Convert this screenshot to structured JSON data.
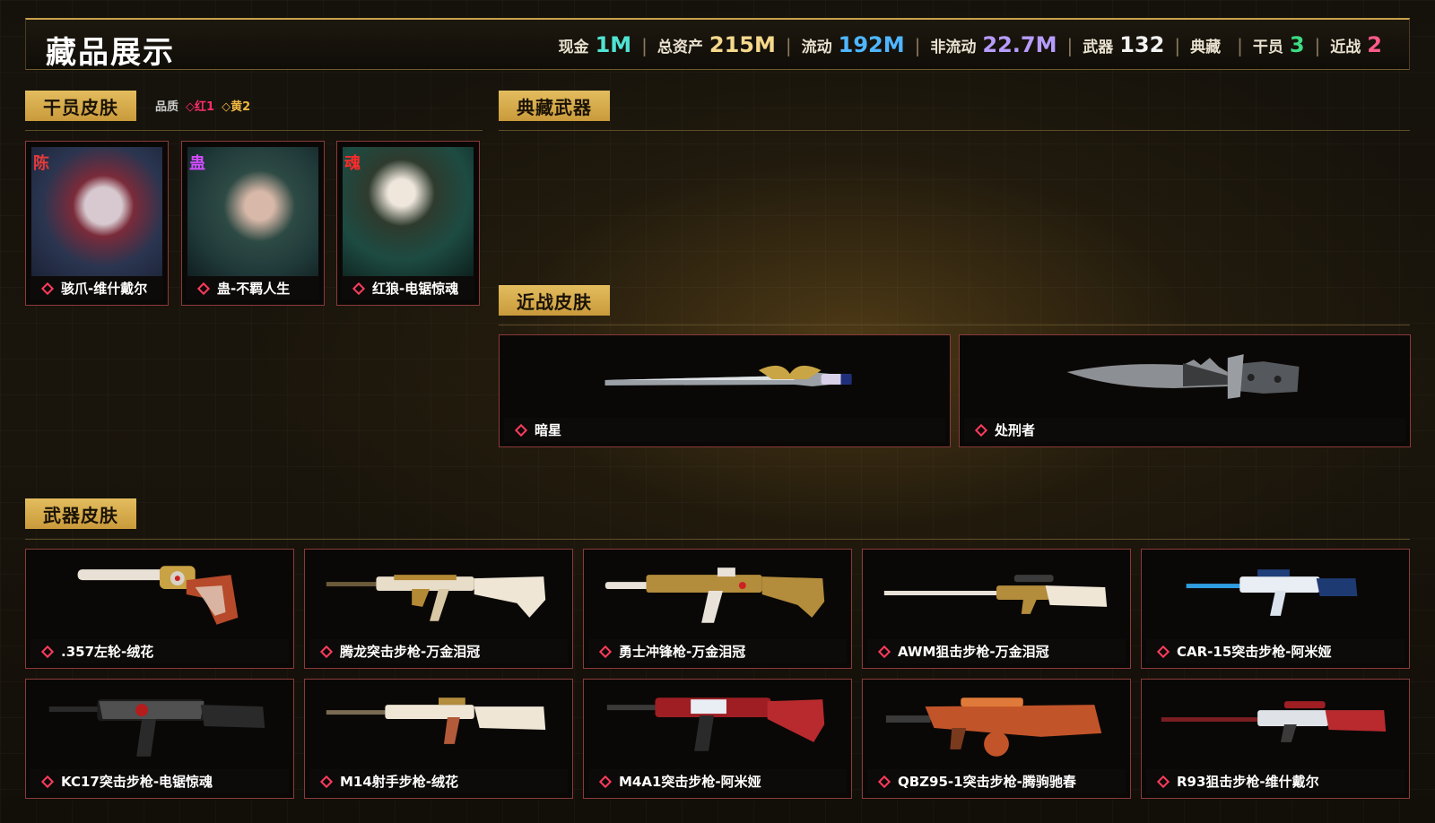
{
  "header": {
    "title": "藏品展示",
    "stats": [
      {
        "label": "现金",
        "value": "1M",
        "color": "#4fe3d2"
      },
      {
        "label": "总资产",
        "value": "215M",
        "color": "#f5d98c"
      },
      {
        "label": "流动",
        "value": "192M",
        "color": "#4fb6ff"
      },
      {
        "label": "非流动",
        "value": "22.7M",
        "color": "#b79cff"
      },
      {
        "label": "武器",
        "value": "132",
        "color": "#f2f2f2"
      },
      {
        "label": "典藏",
        "value": "",
        "color": "#f2f2f2"
      },
      {
        "label": "干员",
        "value": "3",
        "color": "#3ddc84"
      },
      {
        "label": "近战",
        "value": "2",
        "color": "#ff5a8a"
      }
    ]
  },
  "operator_section": {
    "title": "干员皮肤",
    "quality_label": "品质",
    "quality_red": "红1",
    "quality_yellow": "黄2",
    "items": [
      {
        "name": "骇爪-维什戴尔",
        "badge": "陈"
      },
      {
        "name": "蛊-不羁人生",
        "badge": "蛊"
      },
      {
        "name": "红狼-电锯惊魂",
        "badge": "魂"
      }
    ]
  },
  "collection_section": {
    "title": "典藏武器"
  },
  "melee_section": {
    "title": "近战皮肤",
    "items": [
      {
        "name": "暗星",
        "icon": "knife-icon"
      },
      {
        "name": "处刑者",
        "icon": "combat-knife-icon"
      }
    ]
  },
  "weapon_section": {
    "title": "武器皮肤",
    "items": [
      {
        "name": ".357左轮-绒花",
        "icon": "revolver-icon"
      },
      {
        "name": "腾龙突击步枪-万金泪冠",
        "icon": "rifle-icon"
      },
      {
        "name": "勇士冲锋枪-万金泪冠",
        "icon": "smg-icon"
      },
      {
        "name": "AWM狙击步枪-万金泪冠",
        "icon": "sniper-icon"
      },
      {
        "name": "CAR-15突击步枪-阿米娅",
        "icon": "rifle-icon"
      },
      {
        "name": "KC17突击步枪-电锯惊魂",
        "icon": "rifle-icon"
      },
      {
        "name": "M14射手步枪-绒花",
        "icon": "rifle-icon"
      },
      {
        "name": "M4A1突击步枪-阿米娅",
        "icon": "rifle-icon"
      },
      {
        "name": "QBZ95-1突击步枪-腾驹驰春",
        "icon": "rifle-icon"
      },
      {
        "name": "R93狙击步枪-维什戴尔",
        "icon": "sniper-icon"
      }
    ]
  }
}
